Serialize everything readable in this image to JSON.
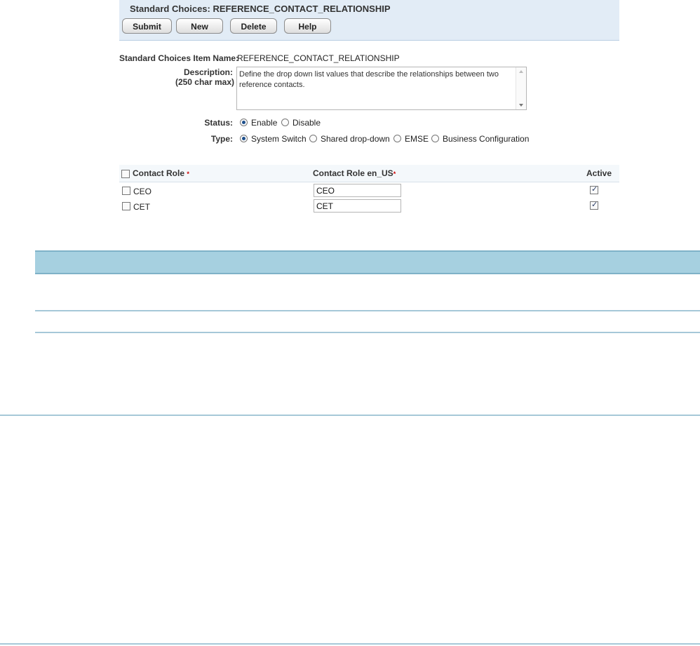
{
  "header": {
    "title_label": "Standard Choices:",
    "title_value": "REFERENCE_CONTACT_RELATIONSHIP",
    "buttons": {
      "submit": "Submit",
      "new": "New",
      "delete": "Delete",
      "help": "Help"
    }
  },
  "form": {
    "item_name_label": "Standard Choices Item Name:",
    "item_name_value": "REFERENCE_CONTACT_RELATIONSHIP",
    "description_label": "Description:",
    "description_sublabel": "(250 char max)",
    "description_value": "Define the drop down list values that describe the relationships between two reference contacts.",
    "status_label": "Status:",
    "status_options": [
      "Enable",
      "Disable"
    ],
    "status_selected": "Enable",
    "type_label": "Type:",
    "type_options": [
      "System Switch",
      "Shared drop-down",
      "EMSE",
      "Business Configuration"
    ],
    "type_selected": "System Switch"
  },
  "grid": {
    "columns": {
      "contact_role": "Contact Role",
      "contact_role_locale": "Contact Role  en_US",
      "active": "Active"
    },
    "required_marker": "*",
    "rows": [
      {
        "role": "CEO",
        "role_en_us": "CEO",
        "active": true
      },
      {
        "role": "CET",
        "role_en_us": "CET",
        "active": true
      }
    ]
  }
}
